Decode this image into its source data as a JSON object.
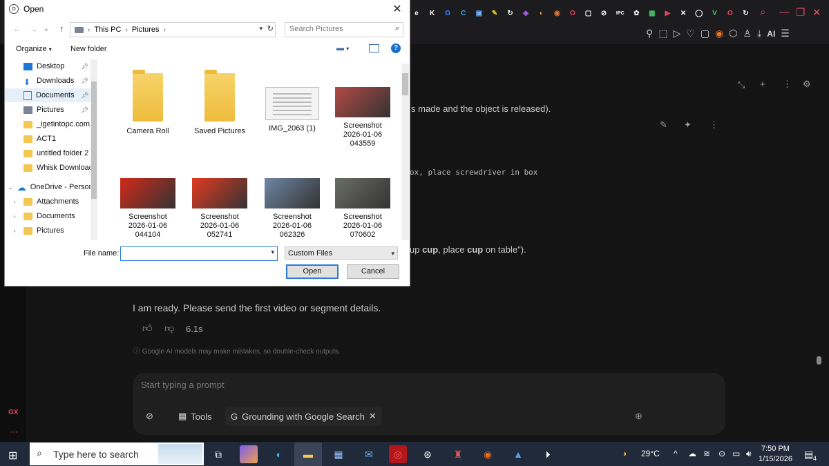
{
  "browser": {
    "extension_icons": [
      "e",
      "K",
      "G",
      "C",
      "▣",
      "✎",
      "↻",
      "◈",
      "◐",
      "◉",
      "O",
      "▢",
      "⊘",
      "IPC",
      "✿",
      "▦",
      "▶",
      "✕",
      "◯",
      "V",
      "O",
      "↻"
    ],
    "ai_label": "AI",
    "gx_label": "GX"
  },
  "chat": {
    "line1": "s made and the object is released).",
    "line2_mono": "ox, place screwdriver in box",
    "line3_pre": "up ",
    "line3_b1": "cup",
    "line3_mid": ", place ",
    "line3_b2": "cup",
    "line3_post": " on table\").",
    "reply": "I am ready. Please send the first video or segment details.",
    "timing": "6.1s",
    "disclaimer": "Google AI models may make mistakes, so double-check outputs.",
    "prompt_placeholder": "Start typing a prompt",
    "tools_label": "Tools",
    "grounding_label": "Grounding with Google Search"
  },
  "dialog": {
    "title": "Open",
    "breadcrumb": [
      "This PC",
      "Pictures"
    ],
    "search_placeholder": "Search Pictures",
    "organize_label": "Organize",
    "new_folder_label": "New folder",
    "nav_items": [
      {
        "label": "Desktop",
        "pinned": true
      },
      {
        "label": "Downloads",
        "pinned": true
      },
      {
        "label": "Documents",
        "pinned": true
      },
      {
        "label": "Pictures",
        "pinned": true
      },
      {
        "label": "_igetintopc.com"
      },
      {
        "label": "ACT1"
      },
      {
        "label": "untitled folder 2"
      },
      {
        "label": "Whisk Download"
      },
      {
        "label": "OneDrive - Person"
      },
      {
        "label": "Attachments"
      },
      {
        "label": "Documents"
      },
      {
        "label": "Pictures"
      }
    ],
    "files": [
      {
        "name": "Camera Roll",
        "kind": "folder"
      },
      {
        "name": "Saved Pictures",
        "kind": "folder"
      },
      {
        "name": "IMG_2063 (1)",
        "kind": "doc"
      },
      {
        "name": "Screenshot\n2026-01-06\n043559",
        "kind": "shot",
        "color": "#b14a45"
      },
      {
        "name": "Screenshot\n2026-01-06\n044104",
        "kind": "shot",
        "color": "#d2291a"
      },
      {
        "name": "Screenshot\n2026-01-06\n052741",
        "kind": "shot",
        "color": "#e23a21"
      },
      {
        "name": "Screenshot\n2026-01-06\n062326",
        "kind": "shot",
        "color": "#6e86a3"
      },
      {
        "name": "Screenshot\n2026-01-06\n070602",
        "kind": "shot",
        "color": "#6b6d66"
      }
    ],
    "file_name_label": "File name:",
    "file_name_value": "",
    "filter_value": "Custom Files",
    "open_label": "Open",
    "cancel_label": "Cancel"
  },
  "taskbar": {
    "search_placeholder": "Type here to search",
    "weather": "29°C",
    "time": "7:50 PM",
    "date": "1/15/2026",
    "notification_count": "4"
  }
}
